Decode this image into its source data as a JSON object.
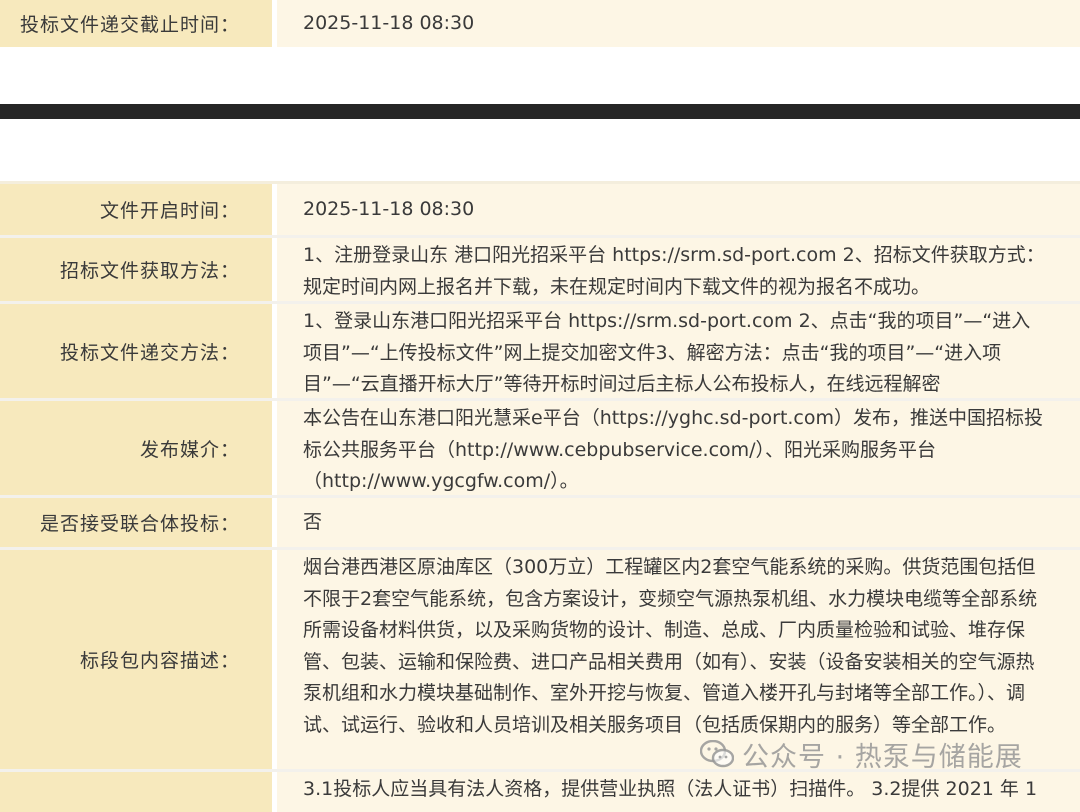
{
  "rows": [
    {
      "label": "投标文件递交截止时间：",
      "value": "2025-11-18 08:30"
    },
    {
      "label": "文件开启时间：",
      "value": "2025-11-18 08:30"
    },
    {
      "label": "招标文件获取方法：",
      "value": "1、注册登录山东 港口阳光招采平台 https://srm.sd-port.com 2、招标文件获取方式：规定时间内网上报名并下载，未在规定时间内下载文件的视为报名不成功。"
    },
    {
      "label": "投标文件递交方法：",
      "value": "1、登录山东港口阳光招采平台 https://srm.sd-port.com 2、点击“我的项目”—“进入项目”—“上传投标文件”网上提交加密文件3、解密方法：点击“我的项目”—“进入项目”—“云直播开标大厅”等待开标时间过后主标人公布投标人，在线远程解密"
    },
    {
      "label": "发布媒介：",
      "value": "本公告在山东港口阳光慧采e平台（https://yghc.sd-port.com）发布，推送中国招标投标公共服务平台（http://www.cebpubservice.com/）、阳光采购服务平台（http://www.ygcgfw.com/）。"
    },
    {
      "label": "是否接受联合体投标：",
      "value": "否"
    },
    {
      "label": "标段包内容描述：",
      "value": "烟台港西港区原油库区（300万立）工程罐区内2套空气能系统的采购。供货范围包括但不限于2套空气能系统，包含方案设计，变频空气源热泵机组、水力模块电缆等全部系统所需设备材料供货，以及采购货物的设计、制造、总成、厂内质量检验和试验、堆存保管、包装、运输和保险费、进口产品相关费用（如有）、安装（设备安装相关的空气源热泵机组和水力模块基础制作、室外开挖与恢复、管道入楼开孔与封堵等全部工作。）、调试、试运行、验收和人员培训及相关服务项目（包括质保期内的服务）等全部工作。"
    },
    {
      "label": "",
      "value": "3.1投标人应当具有法人资格，提供营业执照（法人证书）扫描件。 3.2提供 2021 年 1"
    }
  ],
  "watermark": {
    "text": "公众号 · 热泵与储能展",
    "icon": "wechat-icon"
  }
}
